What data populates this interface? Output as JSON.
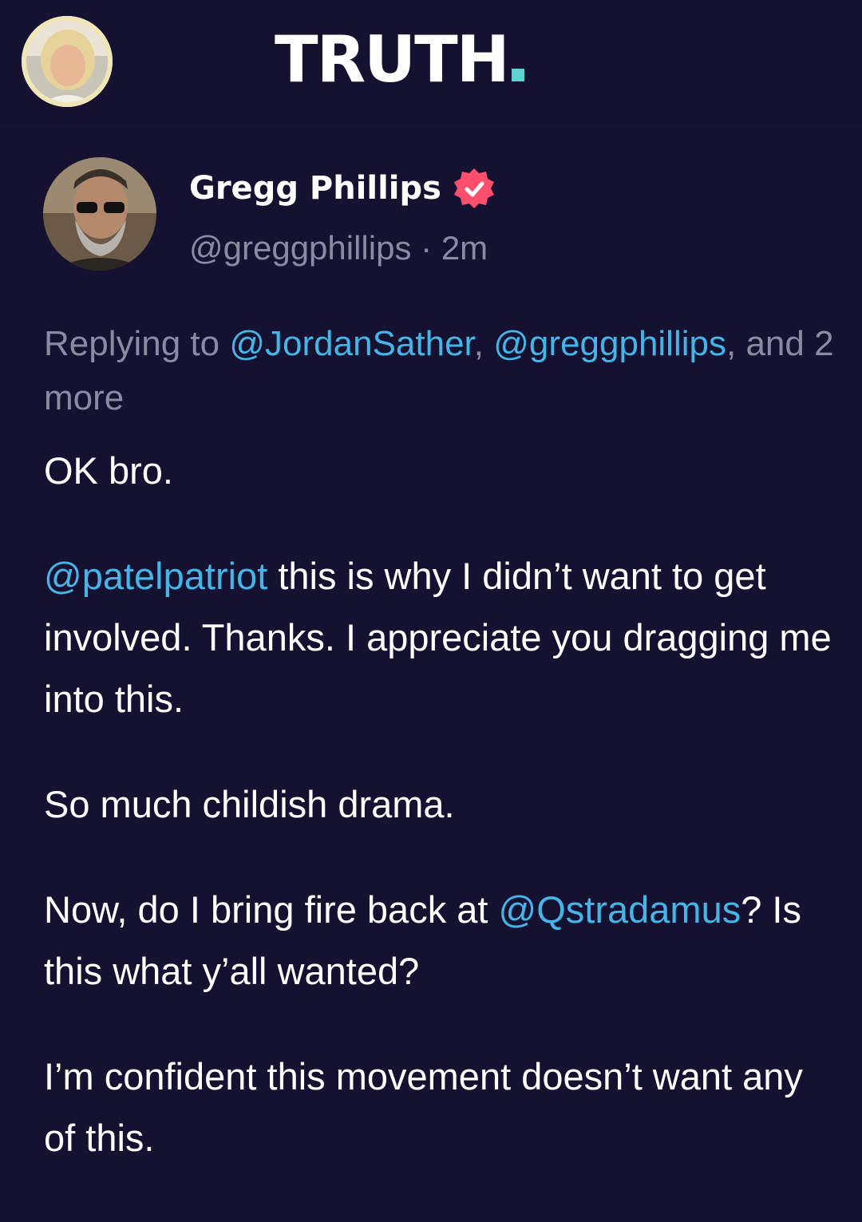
{
  "app": {
    "logo_text": "TRUTH",
    "accent_color": "#5ed3d3",
    "background_color": "#141230",
    "current_user_avatar_icon": "user-avatar-icon"
  },
  "post": {
    "author": {
      "name": "Gregg Phillips",
      "handle": "@greggphillips",
      "separator": "·",
      "time": "2m",
      "verified_icon": "verified-badge-icon",
      "verified_color": "#ff4f6d"
    },
    "replying": {
      "prefix": "Replying to",
      "mention1": "@JordanSather",
      "mention2": "@greggphillips",
      "suffix": "and 2 more"
    },
    "body": {
      "p1": "OK bro.",
      "p2_mention": "@patelpatriot",
      "p2_text": " this is why I didn’t want to get involved. Thanks. I appreciate you dragging me into this.",
      "p3": "So much childish drama.",
      "p4_text1": "Now, do I bring fire back at ",
      "p4_mention": "@Qstradamus",
      "p4_text2": "? Is this what y’all wanted?",
      "p5": "I’m confident this movement doesn’t want any of this."
    },
    "mention_color": "#46b4e6"
  }
}
